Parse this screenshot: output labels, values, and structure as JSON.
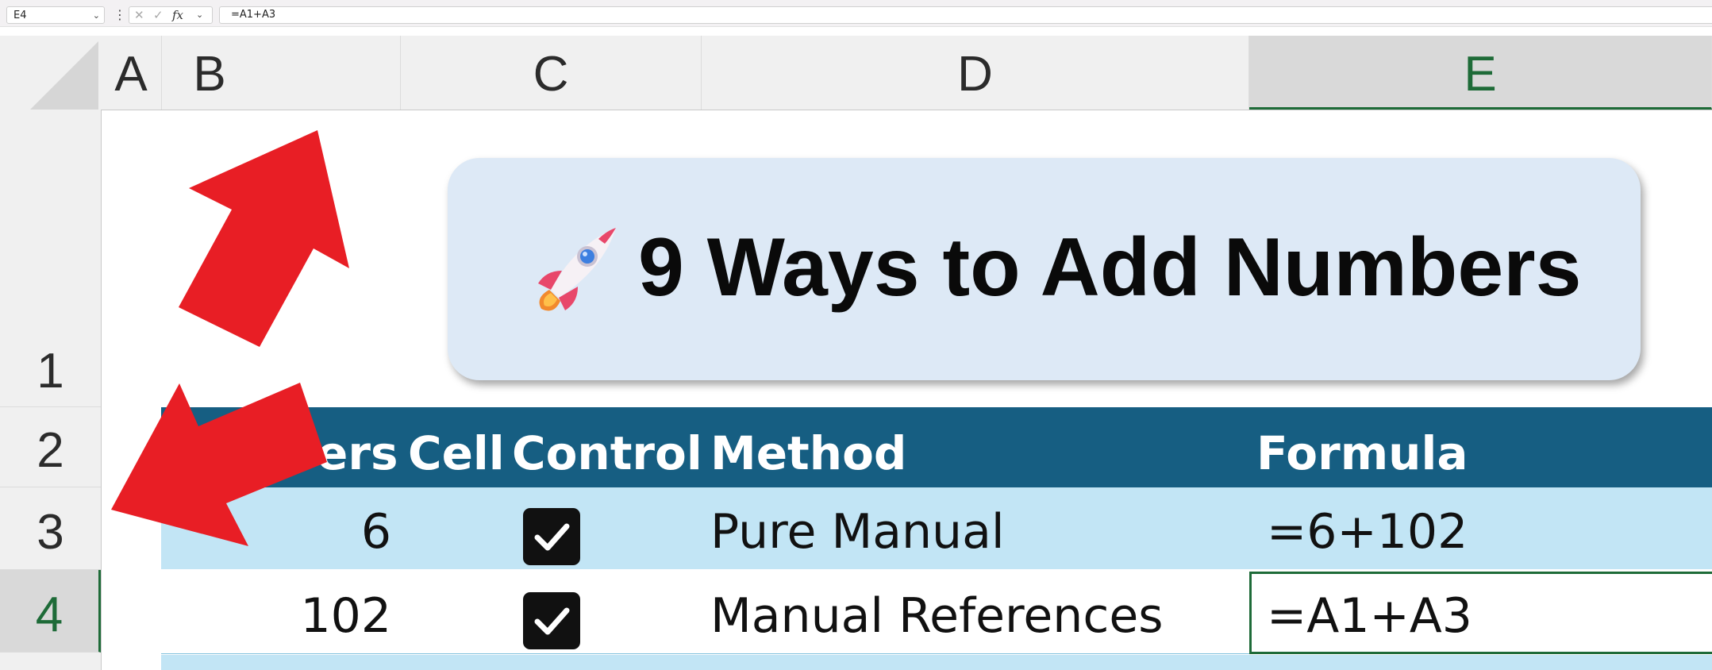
{
  "formula_bar": {
    "cell_ref": "E4",
    "formula": "=A1+A3",
    "fx_label": "fx"
  },
  "columns": [
    "A",
    "B",
    "C",
    "D",
    "E"
  ],
  "selected_column": "E",
  "rows": [
    "1",
    "2",
    "3",
    "4"
  ],
  "selected_row": "4",
  "title": "9 Ways to Add Numbers",
  "table": {
    "headers": [
      "ers",
      "Cell",
      "Control",
      "Method",
      "Formula"
    ],
    "rows": [
      {
        "number": "6",
        "checked": true,
        "method": "Pure Manual",
        "formula": "=6+102"
      },
      {
        "number": "102",
        "checked": true,
        "method": "Manual References",
        "formula": "=A1+A3"
      }
    ]
  },
  "colors": {
    "header_bg": "#165e82",
    "band_bg": "#c2e5f5",
    "title_card_bg": "#dde9f6",
    "arrow": "#e81e25",
    "selection": "#1e6b38"
  }
}
